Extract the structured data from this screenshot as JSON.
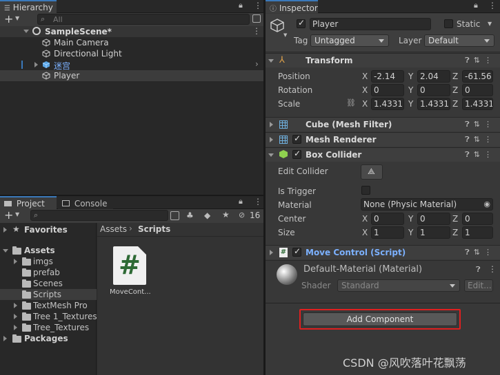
{
  "hierarchy": {
    "tab_label": "Hierarchy",
    "search_placeholder": "All",
    "scene_name": "SampleScene*",
    "items": [
      {
        "label": "Main Camera"
      },
      {
        "label": "Directional Light"
      },
      {
        "label": "迷宫"
      },
      {
        "label": "Player"
      }
    ]
  },
  "project": {
    "tab_project": "Project",
    "tab_console": "Console",
    "hidden_count": "16",
    "favorites": "Favorites",
    "assets": "Assets",
    "folders": [
      "imgs",
      "prefab",
      "Scenes",
      "Scripts",
      "TextMesh Pro",
      "Tree 1_Textures",
      "Tree_Textures"
    ],
    "packages": "Packages",
    "breadcrumb": [
      "Assets",
      "Scripts"
    ],
    "file_label": "MoveCont...",
    "file_glyph": "#"
  },
  "inspector": {
    "tab_label": "Inspector",
    "object_name": "Player",
    "static_label": "Static",
    "tag_label": "Tag",
    "tag_value": "Untagged",
    "layer_label": "Layer",
    "layer_value": "Default",
    "transform": {
      "title": "Transform",
      "position_label": "Position",
      "rotation_label": "Rotation",
      "scale_label": "Scale",
      "position": {
        "x": "-2.14",
        "y": "2.04",
        "z": "-61.56"
      },
      "rotation": {
        "x": "0",
        "y": "0",
        "z": "0"
      },
      "scale": {
        "x": "1.4331",
        "y": "1.4331",
        "z": "1.4331"
      }
    },
    "mesh_filter_title": "Cube (Mesh Filter)",
    "mesh_renderer_title": "Mesh Renderer",
    "box_collider": {
      "title": "Box Collider",
      "edit_collider_label": "Edit Collider",
      "is_trigger_label": "Is Trigger",
      "material_label": "Material",
      "material_value": "None (Physic Material)",
      "center_label": "Center",
      "size_label": "Size",
      "center": {
        "x": "0",
        "y": "0",
        "z": "0"
      },
      "size": {
        "x": "1",
        "y": "1",
        "z": "1"
      }
    },
    "script_title": "Move Control (Script)",
    "material": {
      "name": "Default-Material (Material)",
      "shader_label": "Shader",
      "shader_value": "Standard",
      "edit_label": "Edit..."
    },
    "add_component_label": "Add Component"
  },
  "axis_labels": {
    "x": "X",
    "y": "Y",
    "z": "Z"
  },
  "watermark": "CSDN @风吹落叶花飘荡",
  "colors": {
    "accent": "#3a79bb",
    "highlight_border": "#e02020",
    "script_blue": "#7cb1ff"
  }
}
